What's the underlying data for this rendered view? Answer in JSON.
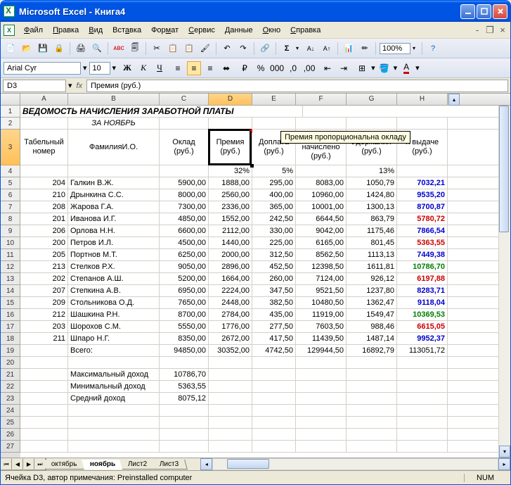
{
  "title": "Microsoft Excel - Книга4",
  "menu": {
    "file": "Файл",
    "edit": "Правка",
    "view": "Вид",
    "insert": "Вставка",
    "format": "Формат",
    "tools": "Сервис",
    "data": "Данные",
    "window": "Окно",
    "help": "Справка"
  },
  "zoom": "100%",
  "font": {
    "name": "Arial Cyr",
    "size": "10"
  },
  "namebox": "D3",
  "formula": "Премия (руб.)",
  "tooltip": "Премия пропорциональна окладу",
  "cols": [
    "A",
    "B",
    "C",
    "D",
    "E",
    "F",
    "G",
    "H"
  ],
  "sheet": {
    "title": "ВЕДОМОСТЬ НАЧИСЛЕНИЯ ЗАРАБОТНОЙ ПЛАТЫ",
    "subtitle": "ЗА НОЯБРЬ",
    "headers": {
      "a": "Табельный номер",
      "b": "ФамилияИ.О.",
      "c": "Оклад (руб.)",
      "d": "Премия (руб.)",
      "e": "Доплата (руб.)",
      "f": "Всего начислено (руб.)",
      "g": "Удержания (руб.)",
      "h": "К выдаче (руб.)"
    },
    "pct": {
      "d": "32%",
      "e": "5%",
      "g": "13%"
    },
    "rows": [
      {
        "n": "204",
        "name": "Галкин В.Ж.",
        "c": "5900,00",
        "d": "1888,00",
        "e": "295,00",
        "f": "8083,00",
        "g": "1050,79",
        "h": "7032,21",
        "cls": "val-blue"
      },
      {
        "n": "210",
        "name": "Дрынкина С.С.",
        "c": "8000,00",
        "d": "2560,00",
        "e": "400,00",
        "f": "10960,00",
        "g": "1424,80",
        "h": "9535,20",
        "cls": "val-blue"
      },
      {
        "n": "208",
        "name": "Жарова Г.А.",
        "c": "7300,00",
        "d": "2336,00",
        "e": "365,00",
        "f": "10001,00",
        "g": "1300,13",
        "h": "8700,87",
        "cls": "val-blue"
      },
      {
        "n": "201",
        "name": "Иванова И.Г.",
        "c": "4850,00",
        "d": "1552,00",
        "e": "242,50",
        "f": "6644,50",
        "g": "863,79",
        "h": "5780,72",
        "cls": "val-red"
      },
      {
        "n": "206",
        "name": "Орлова Н.Н.",
        "c": "6600,00",
        "d": "2112,00",
        "e": "330,00",
        "f": "9042,00",
        "g": "1175,46",
        "h": "7866,54",
        "cls": "val-blue"
      },
      {
        "n": "200",
        "name": "Петров И.Л.",
        "c": "4500,00",
        "d": "1440,00",
        "e": "225,00",
        "f": "6165,00",
        "g": "801,45",
        "h": "5363,55",
        "cls": "val-red"
      },
      {
        "n": "205",
        "name": "Портнов М.Т.",
        "c": "6250,00",
        "d": "2000,00",
        "e": "312,50",
        "f": "8562,50",
        "g": "1113,13",
        "h": "7449,38",
        "cls": "val-blue"
      },
      {
        "n": "213",
        "name": "Стелков Р.Х.",
        "c": "9050,00",
        "d": "2896,00",
        "e": "452,50",
        "f": "12398,50",
        "g": "1611,81",
        "h": "10786,70",
        "cls": "val-green"
      },
      {
        "n": "202",
        "name": "Степанов А.Ш.",
        "c": "5200,00",
        "d": "1664,00",
        "e": "260,00",
        "f": "7124,00",
        "g": "926,12",
        "h": "6197,88",
        "cls": "val-red"
      },
      {
        "n": "207",
        "name": "Степкина А.В.",
        "c": "6950,00",
        "d": "2224,00",
        "e": "347,50",
        "f": "9521,50",
        "g": "1237,80",
        "h": "8283,71",
        "cls": "val-blue"
      },
      {
        "n": "209",
        "name": "Стольникова О.Д.",
        "c": "7650,00",
        "d": "2448,00",
        "e": "382,50",
        "f": "10480,50",
        "g": "1362,47",
        "h": "9118,04",
        "cls": "val-blue"
      },
      {
        "n": "212",
        "name": "Шашкина Р.Н.",
        "c": "8700,00",
        "d": "2784,00",
        "e": "435,00",
        "f": "11919,00",
        "g": "1549,47",
        "h": "10369,53",
        "cls": "val-green"
      },
      {
        "n": "203",
        "name": "Шорохов С.М.",
        "c": "5550,00",
        "d": "1776,00",
        "e": "277,50",
        "f": "7603,50",
        "g": "988,46",
        "h": "6615,05",
        "cls": "val-red"
      },
      {
        "n": "211",
        "name": "Шпаро Н.Г.",
        "c": "8350,00",
        "d": "2672,00",
        "e": "417,50",
        "f": "11439,50",
        "g": "1487,14",
        "h": "9952,37",
        "cls": "val-blue"
      }
    ],
    "total": {
      "label": "Всего:",
      "c": "94850,00",
      "d": "30352,00",
      "e": "4742,50",
      "f": "129944,50",
      "g": "16892,79",
      "h": "113051,72"
    },
    "stats": [
      {
        "label": "Максимальный доход",
        "v": "10786,70"
      },
      {
        "label": "Минимальный доход",
        "v": "5363,55"
      },
      {
        "label": "Средний доход",
        "v": "8075,12"
      }
    ]
  },
  "tabs": [
    "октябрь",
    "ноябрь",
    "Лист2",
    "Лист3"
  ],
  "active_tab": 1,
  "status": "Ячейка D3, автор примечания: Preinstalled computer",
  "numlock": "NUM"
}
